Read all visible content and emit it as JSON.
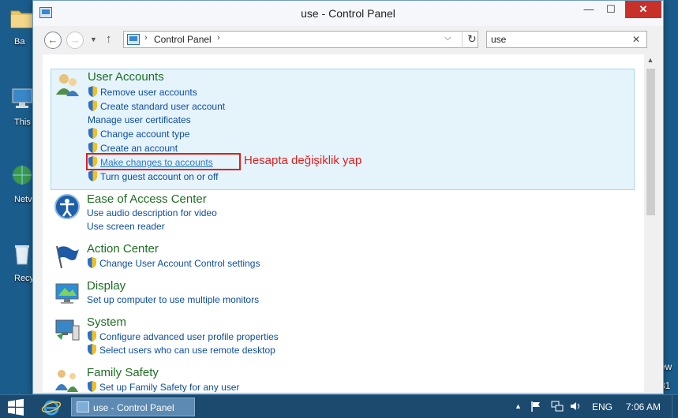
{
  "desktop": {
    "icons": [
      {
        "label": "Ba"
      },
      {
        "label": "This"
      },
      {
        "label": "Netv"
      },
      {
        "label": "Recyc"
      }
    ],
    "right_text": [
      "ew",
      "31"
    ]
  },
  "window": {
    "title": "use - Control Panel",
    "buttons": {
      "minimize": "—",
      "maximize": "☐",
      "close": "✕"
    }
  },
  "toolbar": {
    "back": "←",
    "forward": "→",
    "recent": "▼",
    "up": "↑",
    "breadcrumb_sep": "›",
    "address": "Control Panel",
    "dropdown": "⌵",
    "refresh": "↻",
    "search_value": "use",
    "search_clear": "✕"
  },
  "groups": [
    {
      "title": "User Accounts",
      "links": [
        {
          "label": "Remove user accounts",
          "shield": true
        },
        {
          "label": "Create standard user account",
          "shield": true
        },
        {
          "label": "Manage user certificates",
          "shield": false
        },
        {
          "label": "Change account type",
          "shield": true
        },
        {
          "label": "Create an account",
          "shield": true
        },
        {
          "label": "Make changes to accounts",
          "shield": true
        },
        {
          "label": "Turn guest account on or off",
          "shield": true
        }
      ]
    },
    {
      "title": "Ease of Access Center",
      "links": [
        {
          "label": "Use audio description for video",
          "shield": false
        },
        {
          "label": "Use screen reader",
          "shield": false
        }
      ]
    },
    {
      "title": "Action Center",
      "links": [
        {
          "label": "Change User Account Control settings",
          "shield": true
        }
      ]
    },
    {
      "title": "Display",
      "links": [
        {
          "label": "Set up computer to use multiple monitors",
          "shield": false
        }
      ]
    },
    {
      "title": "System",
      "links": [
        {
          "label": "Configure advanced user profile properties",
          "shield": true
        },
        {
          "label": "Select users who can use remote desktop",
          "shield": true
        }
      ]
    },
    {
      "title": "Family Safety",
      "links": [
        {
          "label": "Set up Family Safety for any user",
          "shield": true
        }
      ]
    }
  ],
  "annotation": {
    "text": "Hesapta değişiklik yap",
    "color": "#e21d1d"
  },
  "taskbar": {
    "task_label": "use - Control Panel",
    "tray_arrow": "▲",
    "language": "ENG",
    "time": "7:06 AM"
  },
  "colors": {
    "group_title": "#1e6d24",
    "link": "#0d4d9e",
    "highlight_bg": "#e5f3fb",
    "taskbar": "#1c4a6f",
    "close_button": "#c7312a"
  }
}
